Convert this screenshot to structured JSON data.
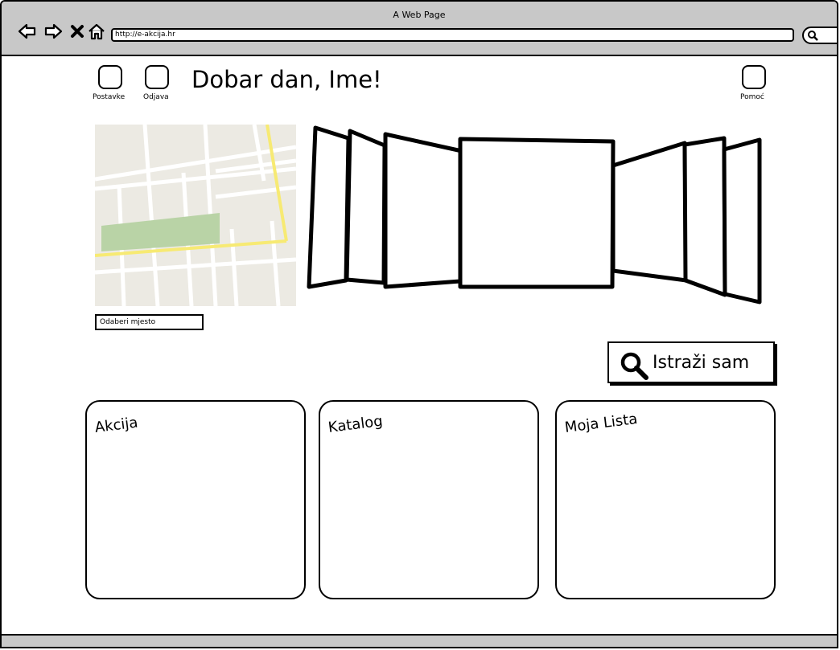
{
  "window": {
    "title": "A Web Page",
    "url": "http://e-akcija.hr"
  },
  "header": {
    "settings_label": "Postavke",
    "logout_label": "Odjava",
    "greeting": "Dobar dan, Ime!",
    "help_label": "Pomoć"
  },
  "location": {
    "picker_label": "Odaberi mjesto"
  },
  "explore": {
    "label": "Istraži sam"
  },
  "cards": [
    {
      "title": "Akcija"
    },
    {
      "title": "Katalog"
    },
    {
      "title": "Moja Lista"
    }
  ],
  "colors": {
    "chrome": "#c8c8c8",
    "map_bg": "#eceae3",
    "map_road": "#ffffff",
    "map_highway": "#f7ea73",
    "map_park": "#b9d3a6"
  }
}
